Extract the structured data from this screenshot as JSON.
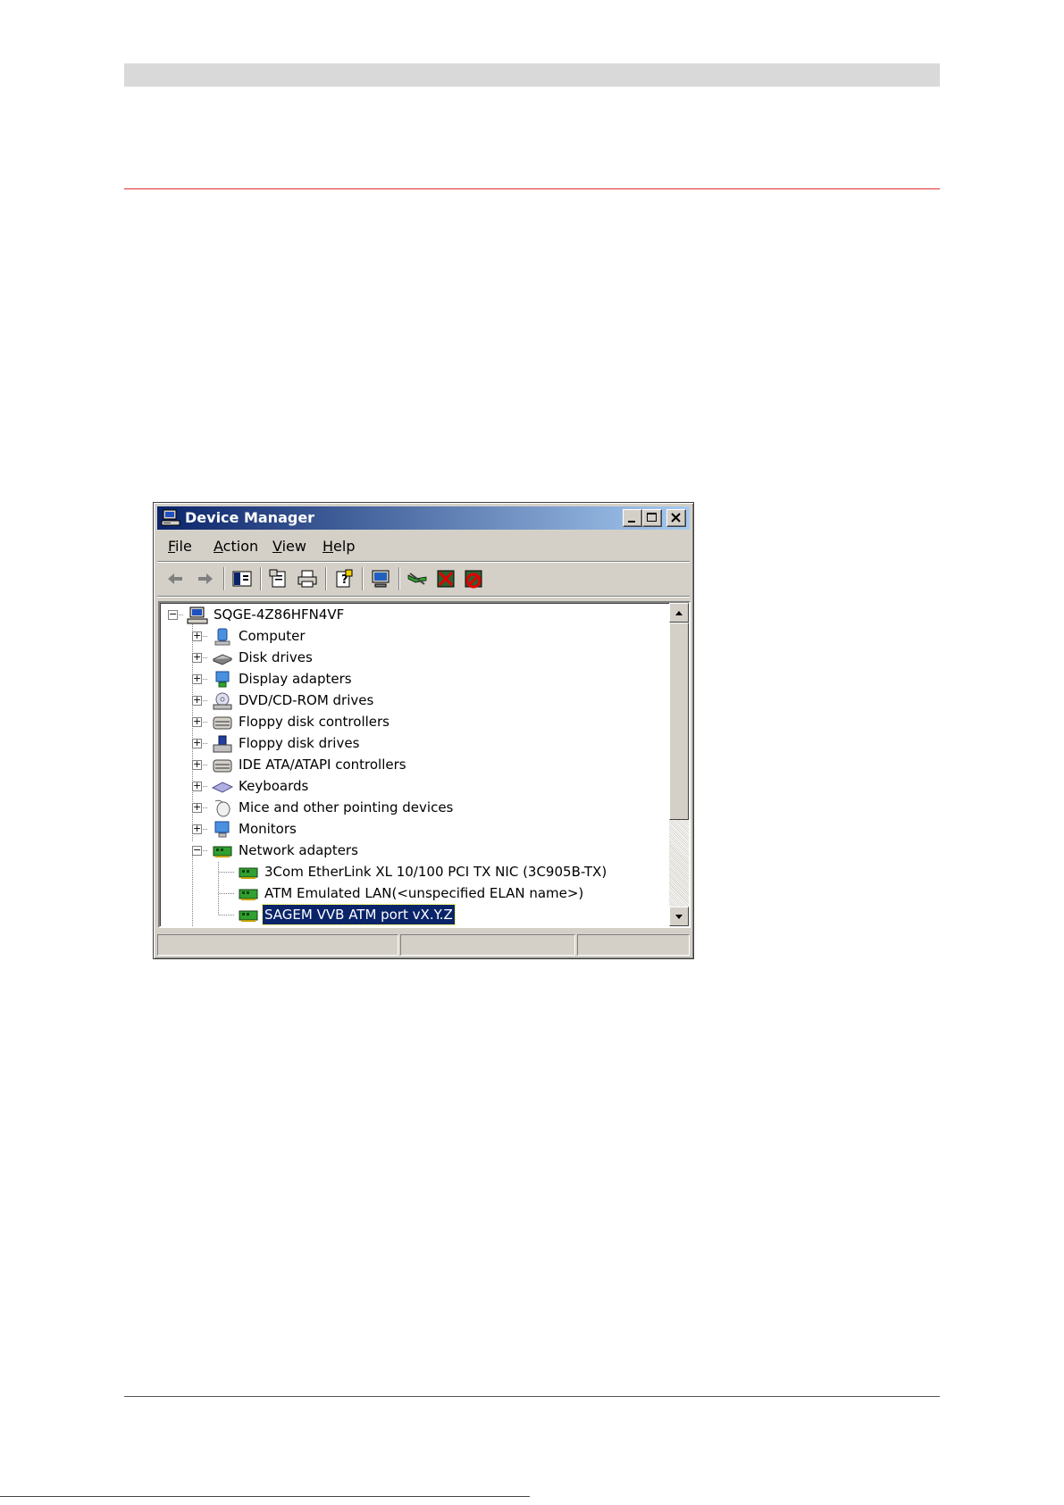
{
  "window": {
    "title": "Device Manager",
    "menu": [
      {
        "prefix": "",
        "underline": "F",
        "rest": "ile"
      },
      {
        "prefix": "",
        "underline": "A",
        "rest": "ction"
      },
      {
        "prefix": "",
        "underline": "V",
        "rest": "iew"
      },
      {
        "prefix": "",
        "underline": "H",
        "rest": "elp"
      }
    ],
    "toolbar_icons": [
      "back-icon",
      "forward-icon",
      "show-hide-tree-icon",
      "properties-icon",
      "print-icon",
      "help-icon",
      "scan-hardware-icon",
      "update-driver-icon",
      "uninstall-icon",
      "disable-icon"
    ],
    "tree": {
      "root": "SQGE-4Z86HFN4VF",
      "categories": [
        {
          "label": "Computer",
          "icon": "computer-icon"
        },
        {
          "label": "Disk drives",
          "icon": "disk-drive-icon"
        },
        {
          "label": "Display adapters",
          "icon": "display-adapter-icon"
        },
        {
          "label": "DVD/CD-ROM drives",
          "icon": "dvd-drive-icon"
        },
        {
          "label": "Floppy disk controllers",
          "icon": "controller-icon"
        },
        {
          "label": "Floppy disk drives",
          "icon": "floppy-drive-icon"
        },
        {
          "label": "IDE ATA/ATAPI controllers",
          "icon": "controller-icon"
        },
        {
          "label": "Keyboards",
          "icon": "keyboard-icon"
        },
        {
          "label": "Mice and other pointing devices",
          "icon": "mouse-icon"
        },
        {
          "label": "Monitors",
          "icon": "monitor-icon"
        },
        {
          "label": "Network adapters",
          "icon": "network-card-icon"
        }
      ],
      "network_children": [
        "3Com EtherLink XL 10/100 PCI TX NIC (3C905B-TX)",
        "ATM Emulated LAN(<unspecified ELAN name>)",
        "SAGEM VVB ATM port vX.Y.Z"
      ],
      "selected": "SAGEM VVB ATM port vX.Y.Z"
    }
  }
}
